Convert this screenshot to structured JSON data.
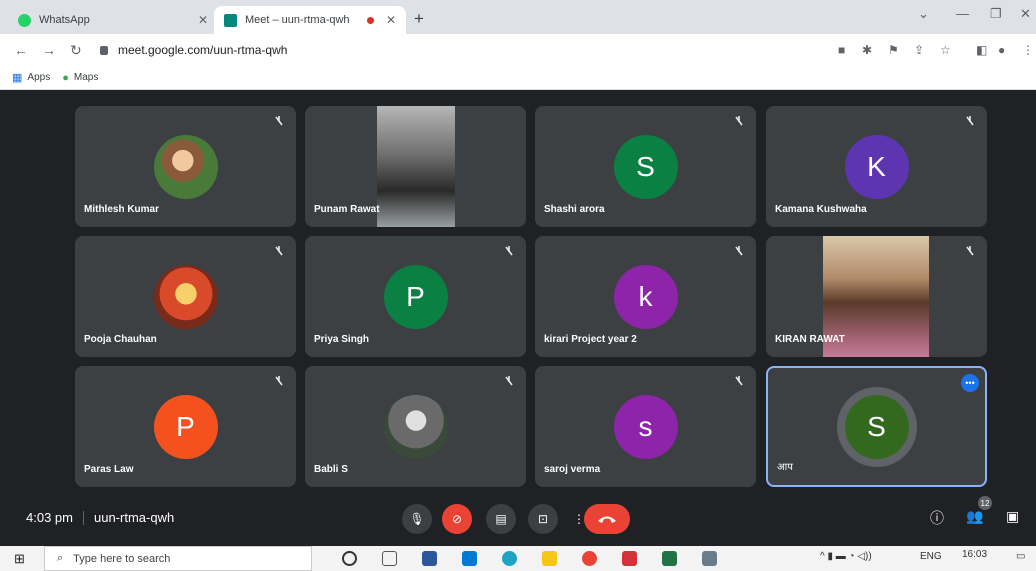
{
  "browser": {
    "tabs": [
      {
        "title": "WhatsApp",
        "active": false
      },
      {
        "title": "Meet – uun-rtma-qwh",
        "active": true
      }
    ],
    "url": "meet.google.com/uun-rtma-qwh",
    "bookmarks": [
      {
        "label": "Apps",
        "icon": "apps-grid-icon"
      },
      {
        "label": "Maps",
        "icon": "maps-pin-icon"
      }
    ]
  },
  "meet": {
    "tiles": [
      {
        "name": "Mithlesh Kumar",
        "kind": "photo",
        "muted": true
      },
      {
        "name": "Punam Rawat",
        "kind": "video",
        "muted": false
      },
      {
        "name": "Shashi arora",
        "kind": "letter",
        "letter": "S",
        "color": "#0b8043",
        "muted": true
      },
      {
        "name": "Kamana Kushwaha",
        "kind": "letter",
        "letter": "K",
        "color": "#5e35b1",
        "muted": true
      },
      {
        "name": "Pooja Chauhan",
        "kind": "photo",
        "muted": true
      },
      {
        "name": "Priya Singh",
        "kind": "letter",
        "letter": "P",
        "color": "#0b8043",
        "muted": true
      },
      {
        "name": "kirari Project year 2",
        "kind": "letter",
        "letter": "k",
        "color": "#8e24aa",
        "muted": true
      },
      {
        "name": "KIRAN RAWAT",
        "kind": "video",
        "muted": true
      },
      {
        "name": "Paras Law",
        "kind": "letter",
        "letter": "P",
        "color": "#f4511e",
        "muted": true
      },
      {
        "name": "Babli S",
        "kind": "photo",
        "muted": true
      },
      {
        "name": "saroj verma",
        "kind": "letter",
        "letter": "s",
        "color": "#8e24aa",
        "muted": true
      },
      {
        "name": "आप",
        "kind": "self",
        "letter": "S",
        "color": "#33691e",
        "muted": false
      }
    ],
    "time": "4:03 pm",
    "meeting_code": "uun-rtma-qwh",
    "participant_count": "12"
  },
  "taskbar": {
    "search_placeholder": "Type here to search",
    "language": "ENG",
    "clock_time": "16:03"
  }
}
